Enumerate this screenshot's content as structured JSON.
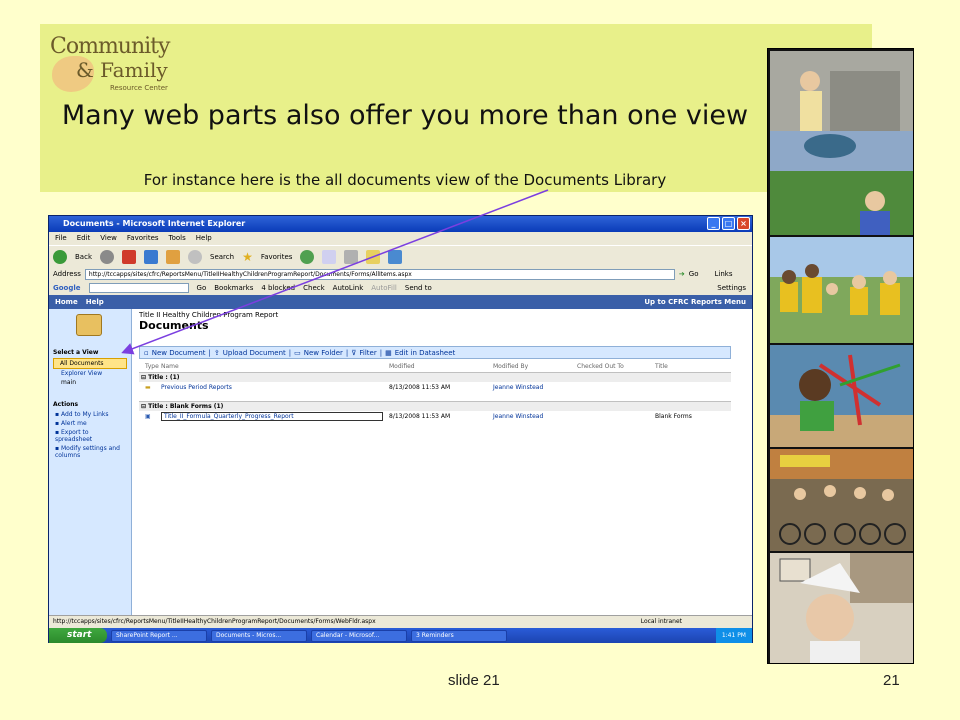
{
  "slide": {
    "title": "Many web parts also offer you more than one view",
    "subtitle": "For instance here is the all documents view of the Documents Library",
    "footer_label": "slide 21",
    "slide_number": "21"
  },
  "logo": {
    "line1": "Community",
    "line2": "& Family",
    "line3": "Resource Center"
  },
  "browser": {
    "window_title": "Documents - Microsoft Internet Explorer",
    "menu": [
      "File",
      "Edit",
      "View",
      "Favorites",
      "Tools",
      "Help"
    ],
    "toolbar": {
      "back": "Back",
      "search": "Search",
      "favorites": "Favorites"
    },
    "address_label": "Address",
    "address": "http://tccapps/sites/cfrc/ReportsMenu/TitleIIHealthyChildrenProgramReport/Documents/Forms/AllItems.aspx",
    "go": "Go",
    "links": "Links",
    "google": {
      "label": "Google",
      "go": "Go",
      "bookmarks": "Bookmarks",
      "blocked": "4 blocked",
      "check": "Check",
      "autolink": "AutoLink",
      "autofill": "AutoFill",
      "sendto": "Send to",
      "settings": "Settings"
    }
  },
  "sharepoint": {
    "top_nav": {
      "home": "Home",
      "help": "Help",
      "up": "Up to CFRC Reports Menu"
    },
    "breadcrumb": "Title II Healthy Children Program Report",
    "page_title": "Documents",
    "views_header": "Select a View",
    "views": [
      "All Documents",
      "Explorer View",
      "main"
    ],
    "actions_header": "Actions",
    "actions": [
      "Add to My Links",
      "Alert me",
      "Export to spreadsheet",
      "Modify settings and columns"
    ],
    "toolbar": {
      "new_doc": "New Document",
      "upload": "Upload Document",
      "new_folder": "New Folder",
      "filter": "Filter",
      "datasheet": "Edit in Datasheet"
    },
    "columns": {
      "type": "Type",
      "name": "Name",
      "modified": "Modified",
      "modified_by": "Modified By",
      "checked_out": "Checked Out To",
      "title": "Title"
    },
    "groups": [
      {
        "label": "Title : (1)",
        "rows": [
          {
            "name": "Previous Period Reports",
            "modified": "8/13/2008 11:53 AM",
            "by": "Jeanne Winstead",
            "title": ""
          }
        ]
      },
      {
        "label": "Title : Blank Forms (1)",
        "rows": [
          {
            "name": "Title_II_Formula_Quarterly_Progress_Report",
            "modified": "8/13/2008 11:53 AM",
            "by": "Jeanne Winstead",
            "title": "Blank Forms"
          }
        ]
      }
    ]
  },
  "status": {
    "url": "http://tccapps/sites/cfrc/ReportsMenu/TitleIIHealthyChildrenProgramReport/Documents/Forms/WebFldr.aspx",
    "zone": "Local intranet"
  },
  "taskbar": {
    "start": "start",
    "tasks": [
      "SharePoint Report ...",
      "Documents - Micros...",
      "Calendar - Microsof...",
      "3 Reminders"
    ],
    "time": "1:41 PM"
  },
  "colors": {
    "slide_bg": "#FFFFCC",
    "header_band": "#E8F08A",
    "arrow": "#7B3FE0"
  }
}
